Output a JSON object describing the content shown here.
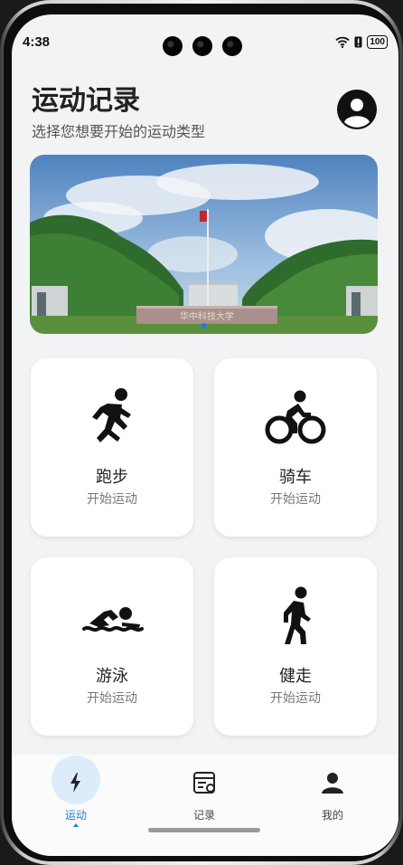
{
  "status": {
    "time": "4:38",
    "battery": "100"
  },
  "header": {
    "title": "运动记录",
    "subtitle": "选择您想要开始的运动类型"
  },
  "banner": {
    "sign_text": "华中科技大学",
    "page_count": 1,
    "active_page": 1
  },
  "sports": [
    {
      "name": "跑步",
      "hint": "开始运动",
      "icon": "running-icon"
    },
    {
      "name": "骑车",
      "hint": "开始运动",
      "icon": "cycling-icon"
    },
    {
      "name": "游泳",
      "hint": "开始运动",
      "icon": "swimming-icon"
    },
    {
      "name": "健走",
      "hint": "开始运动",
      "icon": "walking-icon"
    }
  ],
  "tabs": [
    {
      "label": "运动",
      "icon": "lightning-icon",
      "active": true
    },
    {
      "label": "记录",
      "icon": "record-icon",
      "active": false
    },
    {
      "label": "我的",
      "icon": "person-icon",
      "active": false
    }
  ],
  "colors": {
    "accent": "#1e7bd8",
    "background": "#f1f3f5",
    "card": "#ffffff"
  }
}
